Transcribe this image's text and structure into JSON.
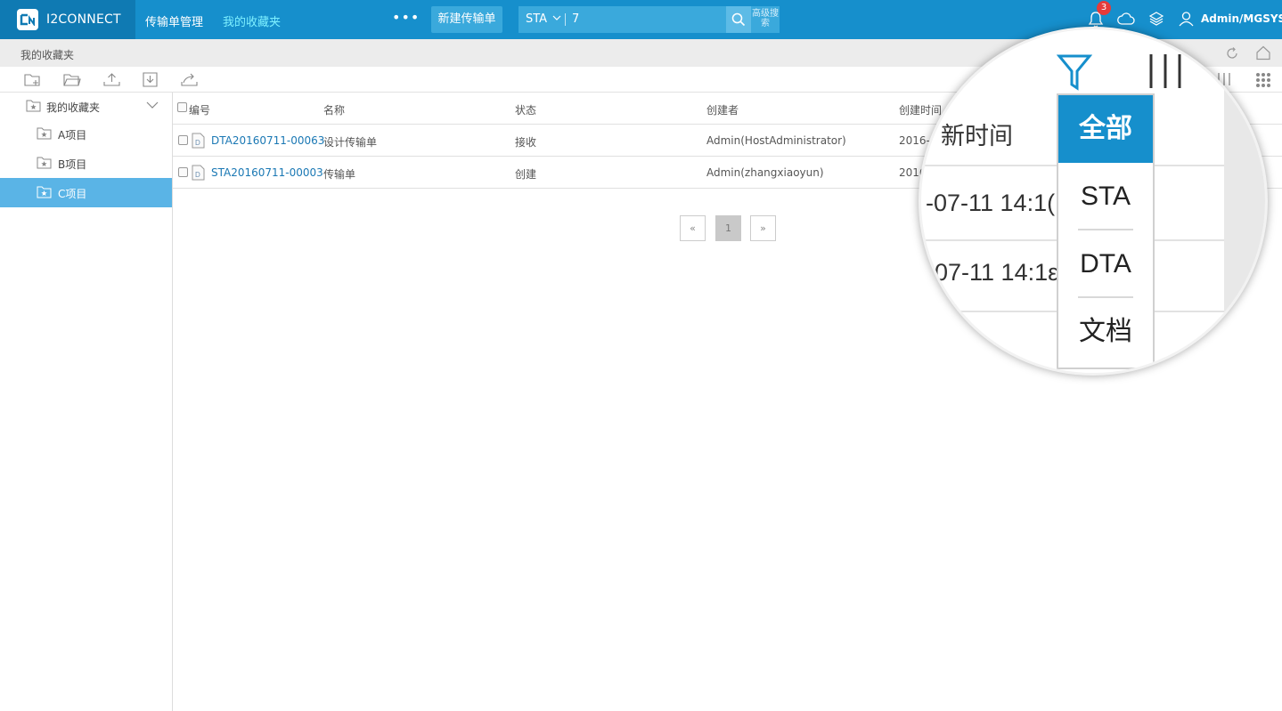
{
  "app": {
    "name": "I2CONNECT"
  },
  "topnav": {
    "item1": "传输单管理",
    "item2": "我的收藏夹",
    "more": "•••"
  },
  "actions": {
    "new_button": "新建传输单"
  },
  "search": {
    "type": "STA",
    "value": "7",
    "advanced": "高级搜索"
  },
  "notifications": {
    "count": "3"
  },
  "user": {
    "name": "Admin/MGSYS"
  },
  "breadcrumb": {
    "current": "我的收藏夹"
  },
  "sidebar": {
    "root": "我的收藏夹",
    "items": [
      {
        "label": "A项目",
        "active": false
      },
      {
        "label": "B项目",
        "active": false
      },
      {
        "label": "C项目",
        "active": true
      }
    ]
  },
  "table": {
    "headers": {
      "id": "编号",
      "name": "名称",
      "status": "状态",
      "creator": "创建者",
      "created": "创建时间"
    },
    "rows": [
      {
        "id": "DTA20160711-00063",
        "name": "设计传输单",
        "status": "接收",
        "creator": "Admin(HostAdministrator)",
        "created": "2016-0"
      },
      {
        "id": "STA20160711-00003",
        "name": "传输单",
        "status": "创建",
        "creator": "Admin(zhangxiaoyun)",
        "created": "2016"
      }
    ]
  },
  "pagination": {
    "prev": "«",
    "current": "1",
    "next": "»"
  },
  "magnifier": {
    "header_fragment": "新时间",
    "row1_fragment": "-07-11 14:1(",
    "row2_fragment": "07-11 14:1ε",
    "filter_options": [
      "全部",
      "STA",
      "DTA",
      "文档"
    ],
    "selected_filter": "全部",
    "columns_glyph": "|||"
  },
  "colors": {
    "topbar": "#168fcc",
    "accent": "#5ab4e6",
    "link": "#1a78b4",
    "badge": "#e53b3b"
  }
}
